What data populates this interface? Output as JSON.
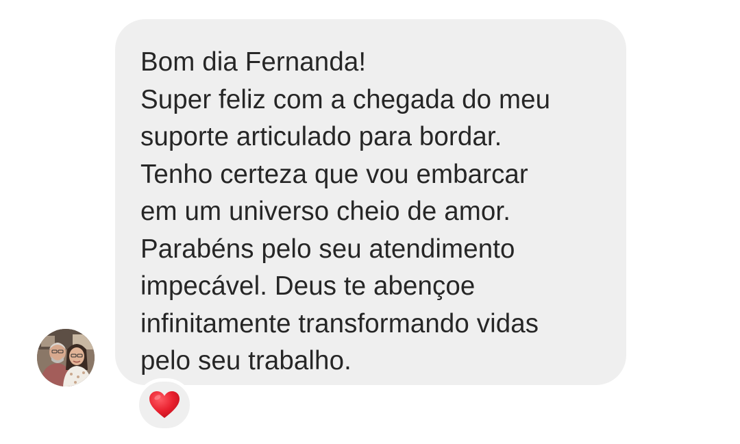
{
  "message": {
    "lines": [
      "Bom dia Fernanda!",
      "Super feliz com a chegada do meu",
      "suporte articulado para bordar.",
      "Tenho certeza que vou embarcar",
      "em um universo cheio de amor.",
      "Parabéns pelo seu atendimento",
      "impecável. Deus te abençoe",
      "infinitamente transformando vidas",
      "pelo seu trabalho."
    ],
    "bubble_color": "#efefef",
    "text_color": "#262626"
  },
  "reaction": {
    "icon": "red-heart-icon",
    "color": "#e8202e"
  },
  "sender": {
    "avatar": "avatar-photo"
  }
}
